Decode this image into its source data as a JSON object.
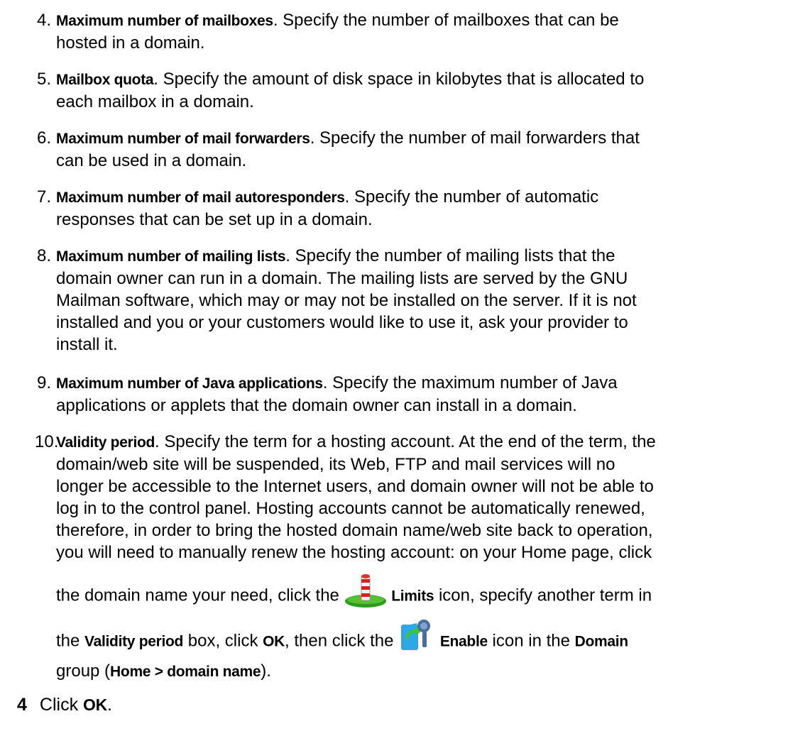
{
  "items": [
    {
      "number": "4.",
      "term": "Maximum number of mailboxes",
      "lines": [
        "Specify the number of mailboxes that can be",
        "hosted in a domain."
      ]
    },
    {
      "number": "5.",
      "term": "Mailbox quota",
      "lines": [
        "Specify the amount of disk space in kilobytes that is allocated to",
        "each mailbox in a domain."
      ]
    },
    {
      "number": "6.",
      "term": "Maximum number of mail forwarders",
      "lines": [
        "Specify the number of mail forwarders that",
        "can be used in a domain."
      ]
    },
    {
      "number": "7.",
      "term": "Maximum number of mail autoresponders",
      "lines": [
        "Specify the number of automatic",
        "responses that can be set up in a domain."
      ]
    },
    {
      "number": "8.",
      "term": "Maximum number of mailing lists",
      "lines": [
        "Specify the number of mailing lists that the",
        "domain owner can run in a domain. The mailing lists are served by the GNU",
        "Mailman software, which may or may not be installed on the server. If it is not",
        "installed and you or your customers would like to use it, ask your provider to",
        "install it."
      ]
    },
    {
      "number": "9.",
      "term": "Maximum number of Java applications",
      "lines": [
        "Specify the maximum number of Java",
        "applications or applets that the domain owner can install in a domain."
      ]
    }
  ],
  "item10": {
    "number": "10.",
    "term": "Validity period",
    "lines": [
      "Specify the term for a hosting account. At the end of the term, the",
      "domain/web site will be suspended, its Web, FTP and mail services will no",
      "longer be accessible to the Internet users, and domain owner will not be able to",
      "log in to the control panel. Hosting accounts cannot be automatically renewed,",
      "therefore, in order to bring the hosted domain name/web site back to operation,",
      "you will need to manually renew the hosting account: on your Home page, click"
    ],
    "limits_line": {
      "before": "the domain name your need, click the",
      "icon": "limits-icon",
      "term": "Limits",
      "after": "icon, specify another term in"
    },
    "enable_line": {
      "before": "the",
      "term1": "Validity period",
      "middle": "box, click",
      "ok": "OK",
      "then": ", then click the",
      "icon": "enable-icon",
      "term2": "Enable",
      "after1": "icon in the",
      "term3": "Domain"
    },
    "last_line": {
      "before": "group (",
      "path": "Home > domain name",
      "after": ")."
    }
  },
  "step": {
    "number": "4",
    "text": "Click",
    "ok": "OK",
    "end": "."
  }
}
